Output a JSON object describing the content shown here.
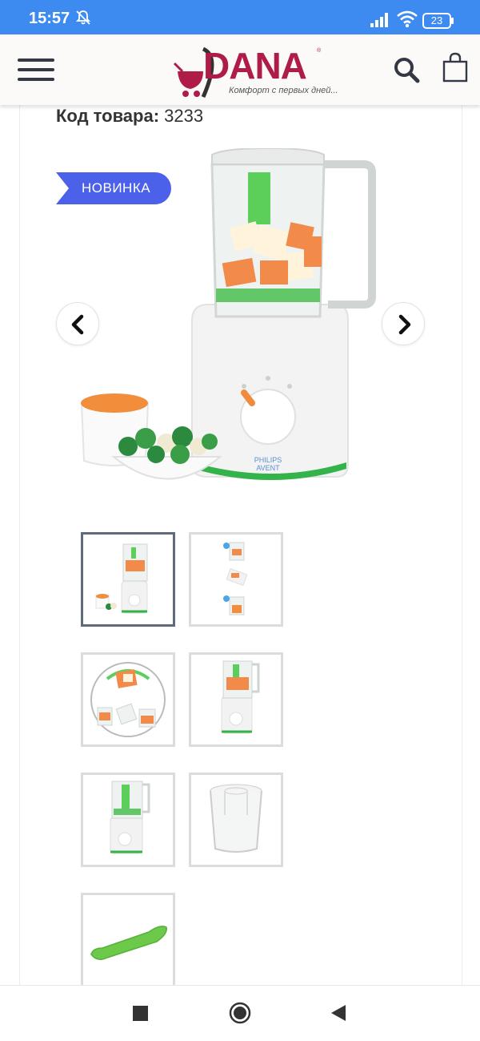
{
  "status_bar": {
    "time": "15:57",
    "battery": "23",
    "icons": [
      "bell-off-icon",
      "signal-icon",
      "wifi-icon",
      "battery-icon"
    ]
  },
  "header": {
    "logo_text": "DANA",
    "logo_tagline": "Комфорт с первых дней...",
    "icons": [
      "hamburger-menu-icon",
      "search-icon",
      "shopping-bag-icon"
    ]
  },
  "product": {
    "sku_label": "Код товара:",
    "sku_value": "3233",
    "badge": "НОВИНКА",
    "brand_top": "PHILIPS",
    "brand_bottom": "AVENT"
  },
  "colors": {
    "status_bar": "#3d8af0",
    "brand": "#b01c48",
    "badge": "#4c61ea",
    "active_thumb_border": "#5d6b7c"
  },
  "gallery": {
    "thumbnail_count": 7,
    "active_index": 0
  }
}
